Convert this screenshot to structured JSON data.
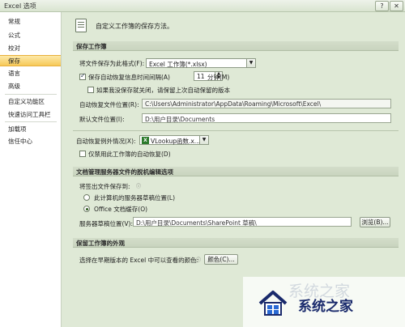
{
  "window": {
    "title": "Excel 选项",
    "help_glyph": "?",
    "close_glyph": "✕"
  },
  "sidebar": {
    "items": [
      {
        "label": "常规"
      },
      {
        "label": "公式"
      },
      {
        "label": "校对"
      },
      {
        "label": "保存"
      },
      {
        "label": "语言"
      },
      {
        "label": "高级"
      },
      {
        "label": "自定义功能区"
      },
      {
        "label": "快速访问工具栏"
      },
      {
        "label": "加载项"
      },
      {
        "label": "信任中心"
      }
    ],
    "active": "保存"
  },
  "header": {
    "text": "自定义工作簿的保存方法。"
  },
  "save_workbooks": {
    "title": "保存工作簿",
    "format_label": "将文件保存为此格式(F):",
    "format_value": "Excel 工作簿(*.xlsx)",
    "autorecover_label": "保存自动恢复信息时间间隔(A)",
    "autorecover_checked": true,
    "autorecover_minutes": "11",
    "minutes_label": "分钟(M)",
    "keep_last_label": "如果我没保存就关闭，请保留上次自动保留的版本",
    "keep_last_checked": false,
    "autorecover_location_label": "自动恢复文件位置(R):",
    "autorecover_location_value": "C:\\Users\\Administrator\\AppData\\Roaming\\Microsoft\\Excel\\",
    "default_location_label": "默认文件位置(I):",
    "default_location_value": "D:\\用户目录\\Documents"
  },
  "autorecover_exceptions": {
    "label": "自动恢复例外情况(X):",
    "workbook_value": "VLookup函数.x...",
    "disable_label": "仅禁用此工作簿的自动恢复(D)",
    "disable_checked": false
  },
  "offline_editing": {
    "title": "文档管理服务器文件的脱机编辑选项",
    "checkout_label": "将签出文件保存到:",
    "option_server": "此计算机的服务器草稿位置(L)",
    "option_cache": "Office 文档缓存(O)",
    "selected": "Office 文档缓存(O)",
    "drafts_label": "服务器草稿位置(V):",
    "drafts_value": "D:\\用户目录\\Documents\\SharePoint 草稿\\",
    "browse_label": "浏览(B)..."
  },
  "preserve_appearance": {
    "title": "保留工作簿的外观",
    "colors_label": "选择在早期版本的 Excel 中可以查看的颜色:",
    "colors_button": "颜色(C)..."
  },
  "watermark": {
    "text": "系统之家",
    "faded_text": "系统之家"
  },
  "colors": {
    "active_nav": "#f6c958",
    "content_bg": "#dfe9d6",
    "logo_blue": "#1a2a6c"
  }
}
